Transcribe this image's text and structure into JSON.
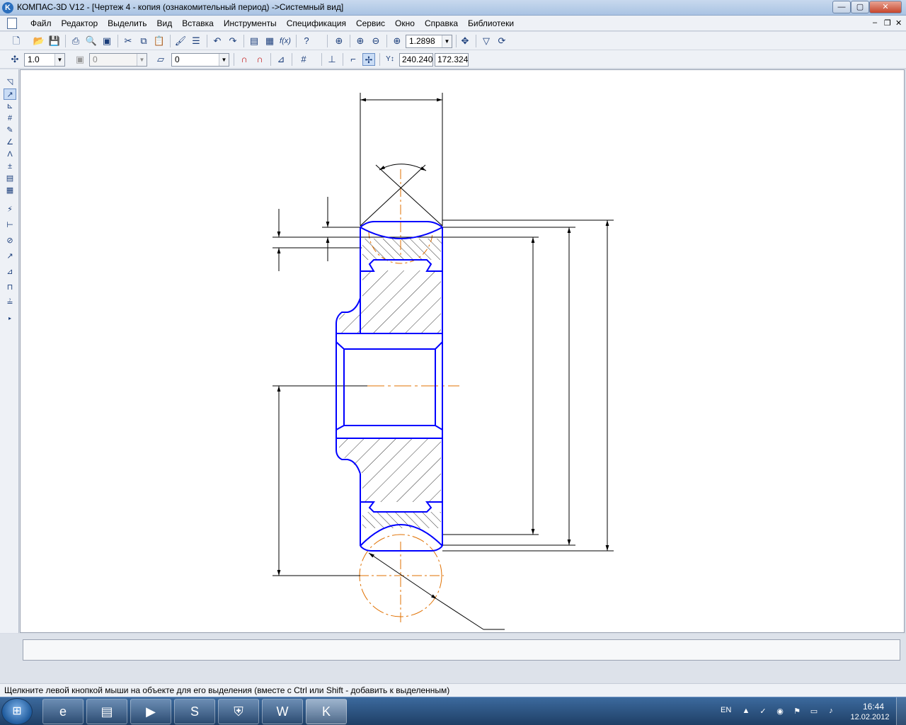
{
  "window": {
    "title": "КОМПАС-3D V12 - [Чертеж 4 - копия (ознакомительный период) ->Системный вид]",
    "controls": {
      "minimize": "—",
      "maximize": "▢",
      "close": "✕"
    }
  },
  "menu": {
    "items": [
      "Файл",
      "Редактор",
      "Выделить",
      "Вид",
      "Вставка",
      "Инструменты",
      "Спецификация",
      "Сервис",
      "Окно",
      "Справка",
      "Библиотеки"
    ],
    "mdi_controls": {
      "minimize": "–",
      "restore": "❐",
      "close": "✕"
    }
  },
  "toolbar_view": {
    "zoom_value": "1.2898"
  },
  "toolbar_current_state": {
    "step_value": "1.0",
    "layer_value": "0",
    "style_value": "0",
    "coord_x": "240.240",
    "coord_y": "172.324"
  },
  "status": {
    "hint": "Щелкните левой кнопкой мыши на объекте для его выделения (вместе с Ctrl или Shift - добавить к выделенным)"
  },
  "colors": {
    "contour": "#0000ff",
    "axis": "#e07000",
    "dimension": "#000000",
    "hatch": "#000000"
  },
  "taskbar": {
    "apps": [
      "start-orb",
      "internet-explorer-icon",
      "file-explorer-icon",
      "media-player-icon",
      "skype-icon",
      "security-shield-icon",
      "word-icon",
      "kompas-icon"
    ],
    "lang": "EN",
    "time": "16:44",
    "date": "12.02.2012"
  }
}
